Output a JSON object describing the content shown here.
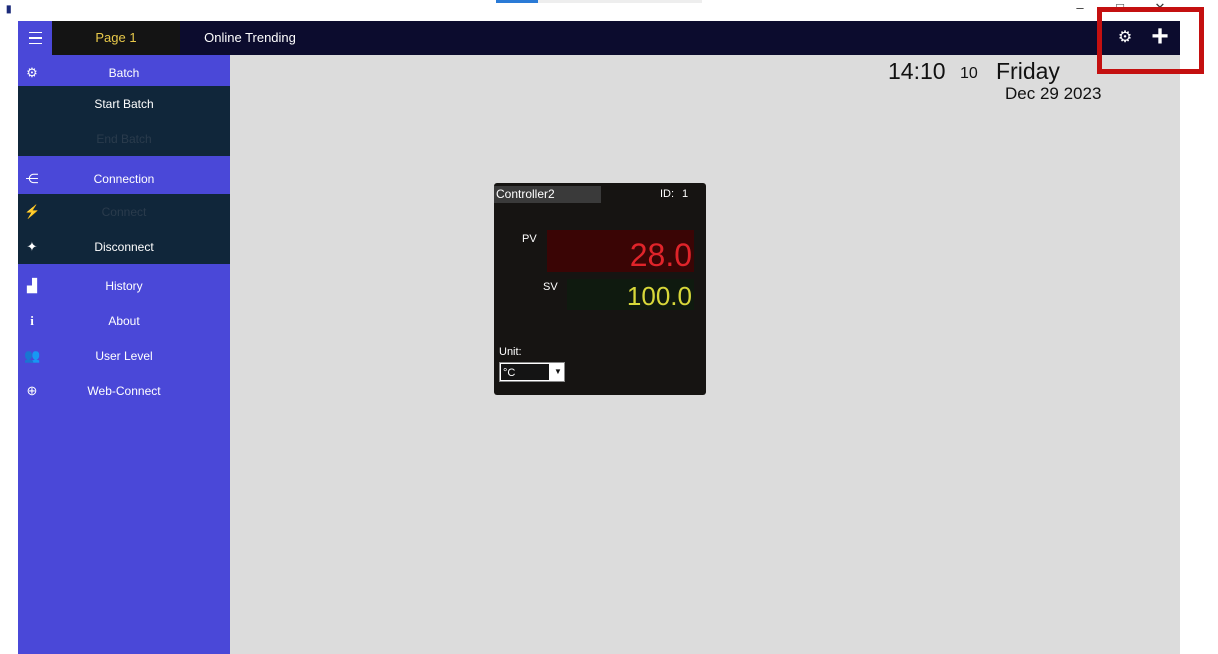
{
  "titlebar": {
    "app_icon": "app-logo-icon",
    "minimize": "–",
    "maximize": "□",
    "close": "✕"
  },
  "topbar": {
    "tabs": [
      {
        "label": "Page 1",
        "active": true
      },
      {
        "label": "Online Trending",
        "active": false
      }
    ],
    "settings_icon": "gear-icon",
    "add_icon": "plus-icon"
  },
  "sidebar": {
    "items": [
      {
        "label": "Batch",
        "icon": "gears-icon",
        "type": "section"
      },
      {
        "label": "Start Batch",
        "type": "sub",
        "enabled": true
      },
      {
        "label": "End Batch",
        "type": "sub",
        "enabled": false
      },
      {
        "label": "Connection",
        "icon": "share-icon",
        "type": "section"
      },
      {
        "label": "Connect",
        "icon": "plug-icon",
        "type": "sub",
        "enabled": false
      },
      {
        "label": "Disconnect",
        "icon": "unplug-icon",
        "type": "sub",
        "enabled": true
      },
      {
        "label": "History",
        "icon": "chart-icon",
        "type": "section"
      },
      {
        "label": "About",
        "icon": "info-icon",
        "type": "section"
      },
      {
        "label": "User Level",
        "icon": "users-icon",
        "type": "section"
      },
      {
        "label": "Web-Connect",
        "icon": "globe-icon",
        "type": "section"
      }
    ]
  },
  "clock": {
    "time": "14:10",
    "seconds": "10",
    "day": "Friday",
    "date": "Dec 29 2023"
  },
  "controller": {
    "name": "Controller2",
    "id_label": "ID:",
    "id": "1",
    "pv_label": "PV",
    "pv_value": "28.0",
    "sv_label": "SV",
    "sv_value": "100.0",
    "unit_label": "Unit:",
    "unit_value": "°C"
  },
  "colors": {
    "sidebar": "#4a48d8",
    "topbar": "#0c0c2e",
    "submenu": "#10263a",
    "pv": "#e0242a",
    "sv": "#d8d83a",
    "highlight": "#c41010",
    "active_tab_text": "#e8c94a"
  }
}
